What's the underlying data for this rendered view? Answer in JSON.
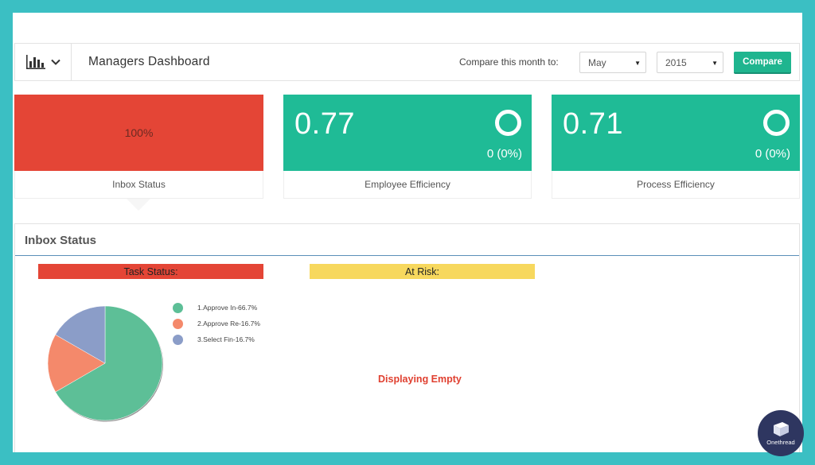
{
  "header": {
    "menu_icon": "bar-chart-icon",
    "dropdown_icon": "chevron-down-icon",
    "title": "Managers Dashboard",
    "compare_label": "Compare this month to:",
    "month_value": "May",
    "year_value": "2015",
    "compare_button": "Compare"
  },
  "cards": {
    "inbox": {
      "value": "100%",
      "label": "Inbox Status",
      "color": "#e44536"
    },
    "employee": {
      "value": "0.77",
      "sub": "0 (0%)",
      "label": "Employee Efficiency",
      "color": "#1fbb96"
    },
    "process": {
      "value": "0.71",
      "sub": "0 (0%)",
      "label": "Process Efficiency",
      "color": "#1fbb96"
    }
  },
  "panel": {
    "title": "Inbox Status",
    "task_status_label": "Task Status:",
    "at_risk_label": "At Risk:",
    "empty_message": "Displaying Empty"
  },
  "chart_data": {
    "type": "pie",
    "categories": [
      "1.Approve In",
      "2.Approve Re",
      "3.Select Fin"
    ],
    "values": [
      66.7,
      16.7,
      16.7
    ],
    "legend": [
      "1.Approve In-66.7%",
      "2.Approve Re-16.7%",
      "3.Select Fin-16.7%"
    ],
    "colors": [
      "#5dbf97",
      "#f4896b",
      "#8b9dc8"
    ],
    "legend_position": "right"
  },
  "branding": {
    "logo_text": "Onethread"
  }
}
